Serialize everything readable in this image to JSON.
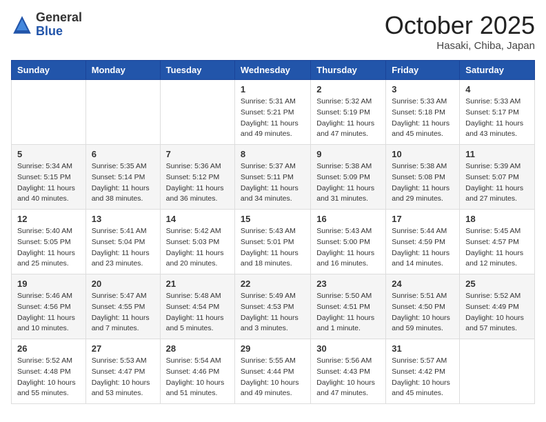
{
  "header": {
    "logo_general": "General",
    "logo_blue": "Blue",
    "month": "October 2025",
    "location": "Hasaki, Chiba, Japan"
  },
  "weekdays": [
    "Sunday",
    "Monday",
    "Tuesday",
    "Wednesday",
    "Thursday",
    "Friday",
    "Saturday"
  ],
  "weeks": [
    [
      {
        "day": "",
        "info": ""
      },
      {
        "day": "",
        "info": ""
      },
      {
        "day": "",
        "info": ""
      },
      {
        "day": "1",
        "info": "Sunrise: 5:31 AM\nSunset: 5:21 PM\nDaylight: 11 hours and 49 minutes."
      },
      {
        "day": "2",
        "info": "Sunrise: 5:32 AM\nSunset: 5:19 PM\nDaylight: 11 hours and 47 minutes."
      },
      {
        "day": "3",
        "info": "Sunrise: 5:33 AM\nSunset: 5:18 PM\nDaylight: 11 hours and 45 minutes."
      },
      {
        "day": "4",
        "info": "Sunrise: 5:33 AM\nSunset: 5:17 PM\nDaylight: 11 hours and 43 minutes."
      }
    ],
    [
      {
        "day": "5",
        "info": "Sunrise: 5:34 AM\nSunset: 5:15 PM\nDaylight: 11 hours and 40 minutes."
      },
      {
        "day": "6",
        "info": "Sunrise: 5:35 AM\nSunset: 5:14 PM\nDaylight: 11 hours and 38 minutes."
      },
      {
        "day": "7",
        "info": "Sunrise: 5:36 AM\nSunset: 5:12 PM\nDaylight: 11 hours and 36 minutes."
      },
      {
        "day": "8",
        "info": "Sunrise: 5:37 AM\nSunset: 5:11 PM\nDaylight: 11 hours and 34 minutes."
      },
      {
        "day": "9",
        "info": "Sunrise: 5:38 AM\nSunset: 5:09 PM\nDaylight: 11 hours and 31 minutes."
      },
      {
        "day": "10",
        "info": "Sunrise: 5:38 AM\nSunset: 5:08 PM\nDaylight: 11 hours and 29 minutes."
      },
      {
        "day": "11",
        "info": "Sunrise: 5:39 AM\nSunset: 5:07 PM\nDaylight: 11 hours and 27 minutes."
      }
    ],
    [
      {
        "day": "12",
        "info": "Sunrise: 5:40 AM\nSunset: 5:05 PM\nDaylight: 11 hours and 25 minutes."
      },
      {
        "day": "13",
        "info": "Sunrise: 5:41 AM\nSunset: 5:04 PM\nDaylight: 11 hours and 23 minutes."
      },
      {
        "day": "14",
        "info": "Sunrise: 5:42 AM\nSunset: 5:03 PM\nDaylight: 11 hours and 20 minutes."
      },
      {
        "day": "15",
        "info": "Sunrise: 5:43 AM\nSunset: 5:01 PM\nDaylight: 11 hours and 18 minutes."
      },
      {
        "day": "16",
        "info": "Sunrise: 5:43 AM\nSunset: 5:00 PM\nDaylight: 11 hours and 16 minutes."
      },
      {
        "day": "17",
        "info": "Sunrise: 5:44 AM\nSunset: 4:59 PM\nDaylight: 11 hours and 14 minutes."
      },
      {
        "day": "18",
        "info": "Sunrise: 5:45 AM\nSunset: 4:57 PM\nDaylight: 11 hours and 12 minutes."
      }
    ],
    [
      {
        "day": "19",
        "info": "Sunrise: 5:46 AM\nSunset: 4:56 PM\nDaylight: 11 hours and 10 minutes."
      },
      {
        "day": "20",
        "info": "Sunrise: 5:47 AM\nSunset: 4:55 PM\nDaylight: 11 hours and 7 minutes."
      },
      {
        "day": "21",
        "info": "Sunrise: 5:48 AM\nSunset: 4:54 PM\nDaylight: 11 hours and 5 minutes."
      },
      {
        "day": "22",
        "info": "Sunrise: 5:49 AM\nSunset: 4:53 PM\nDaylight: 11 hours and 3 minutes."
      },
      {
        "day": "23",
        "info": "Sunrise: 5:50 AM\nSunset: 4:51 PM\nDaylight: 11 hours and 1 minute."
      },
      {
        "day": "24",
        "info": "Sunrise: 5:51 AM\nSunset: 4:50 PM\nDaylight: 10 hours and 59 minutes."
      },
      {
        "day": "25",
        "info": "Sunrise: 5:52 AM\nSunset: 4:49 PM\nDaylight: 10 hours and 57 minutes."
      }
    ],
    [
      {
        "day": "26",
        "info": "Sunrise: 5:52 AM\nSunset: 4:48 PM\nDaylight: 10 hours and 55 minutes."
      },
      {
        "day": "27",
        "info": "Sunrise: 5:53 AM\nSunset: 4:47 PM\nDaylight: 10 hours and 53 minutes."
      },
      {
        "day": "28",
        "info": "Sunrise: 5:54 AM\nSunset: 4:46 PM\nDaylight: 10 hours and 51 minutes."
      },
      {
        "day": "29",
        "info": "Sunrise: 5:55 AM\nSunset: 4:44 PM\nDaylight: 10 hours and 49 minutes."
      },
      {
        "day": "30",
        "info": "Sunrise: 5:56 AM\nSunset: 4:43 PM\nDaylight: 10 hours and 47 minutes."
      },
      {
        "day": "31",
        "info": "Sunrise: 5:57 AM\nSunset: 4:42 PM\nDaylight: 10 hours and 45 minutes."
      },
      {
        "day": "",
        "info": ""
      }
    ]
  ]
}
